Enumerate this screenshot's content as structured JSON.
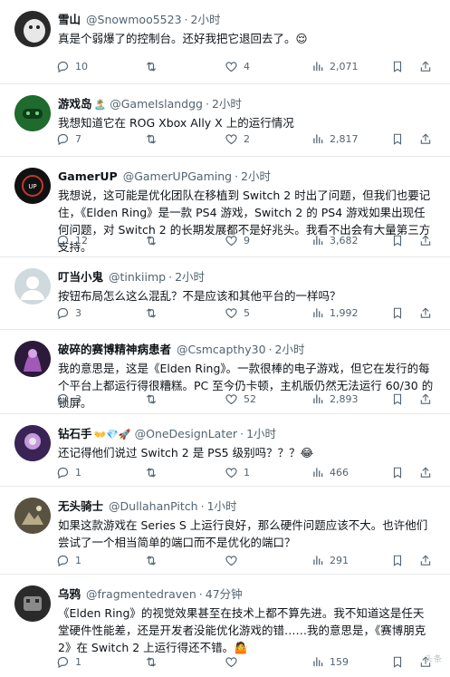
{
  "replies": [
    {
      "name": "雪山",
      "emoji": "",
      "handle": "@Snowmoo5523",
      "time": "2小时",
      "text": "真是个弱爆了的控制台。还好我把它退回去了。😌",
      "stats": {
        "replies": "10",
        "reposts": "",
        "likes": "4",
        "views": "2,071"
      },
      "avatar_colors": [
        "#3b3b3b",
        "#e8e8e8"
      ]
    },
    {
      "name": "游戏岛",
      "emoji": "🏝️",
      "handle": "@GameIslandgg",
      "time": "2小时",
      "text": "我想知道它在 ROG Xbox Ally X 上的运行情况",
      "stats": {
        "replies": "7",
        "reposts": "",
        "likes": "2",
        "views": "2,817"
      },
      "avatar_colors": [
        "#1f6b2e",
        "#2e8b3e"
      ]
    },
    {
      "name": "GamerUP",
      "emoji": "",
      "handle": "@GamerUPGaming",
      "time": "2小时",
      "text": "我想说，这可能是优化团队在移植到 Switch 2 时出了问题，但我们也要记住，《Elden Ring》是一款 PS4 游戏，Switch 2 的 PS4 游戏如果出现任何问题，对 Switch 2 的长期发展都不是好兆头。我看不出会有大量第三方支持。",
      "stats": {
        "replies": "12",
        "reposts": "",
        "likes": "9",
        "views": "3,682"
      },
      "avatar_colors": [
        "#111111",
        "#c0392b"
      ]
    },
    {
      "name": "叮当小鬼",
      "emoji": "",
      "handle": "@tinkiimp",
      "time": "2小时",
      "text": "按钮布局怎么这么混乱？不是应该和其他平台的一样吗？",
      "stats": {
        "replies": "3",
        "reposts": "",
        "likes": "5",
        "views": "1,992"
      },
      "avatar_colors": [
        "#cfd9de",
        "#ffffff"
      ]
    },
    {
      "name": "破碎的赛博精神病患者",
      "emoji": "",
      "handle": "@Csmcapthy30",
      "time": "2小时",
      "text": "我的意思是，这是《Elden Ring》。一款很棒的电子游戏，但它在发行的每个平台上都运行得很糟糕。PC 至今仍卡顿，主机版仍然无法运行 60/30 的锁屏。",
      "stats": {
        "replies": "3",
        "reposts": "",
        "likes": "52",
        "views": "2,893"
      },
      "avatar_colors": [
        "#2c1a3a",
        "#a15ab8"
      ]
    },
    {
      "name": "钻石手",
      "emoji": "👐💎🚀",
      "handle": "@OneDesignLater",
      "time": "1小时",
      "text": "还记得他们说过 Switch 2 是 PS5 级别吗？？？😂",
      "stats": {
        "replies": "1",
        "reposts": "",
        "likes": "1",
        "views": "466"
      },
      "avatar_colors": [
        "#3a2456",
        "#c49ad8"
      ]
    },
    {
      "name": "无头骑士",
      "emoji": "",
      "handle": "@DullahanPitch",
      "time": "1小时",
      "text": "如果这款游戏在 Series S 上运行良好，那么硬件问题应该不大。也许他们尝试了一个相当简单的端口而不是优化的端口？",
      "stats": {
        "replies": "1",
        "reposts": "",
        "likes": "",
        "views": "291"
      },
      "avatar_colors": [
        "#5a5240",
        "#b8ab8a"
      ]
    },
    {
      "name": "乌鸦",
      "emoji": "",
      "handle": "@fragmentedraven",
      "time": "47分钟",
      "text": "《Elden Ring》的视觉效果甚至在技术上都不算先进。我不知道这是任天堂硬件性能差，还是开发者没能优化游戏的错……我的意思是，《赛博朋克2》在 Switch 2 上运行得还不错。🤷",
      "stats": {
        "replies": "1",
        "reposts": "",
        "likes": "",
        "views": "159"
      },
      "avatar_colors": [
        "#2a2a2a",
        "#8a8a8a"
      ]
    }
  ],
  "watermark": "头条"
}
